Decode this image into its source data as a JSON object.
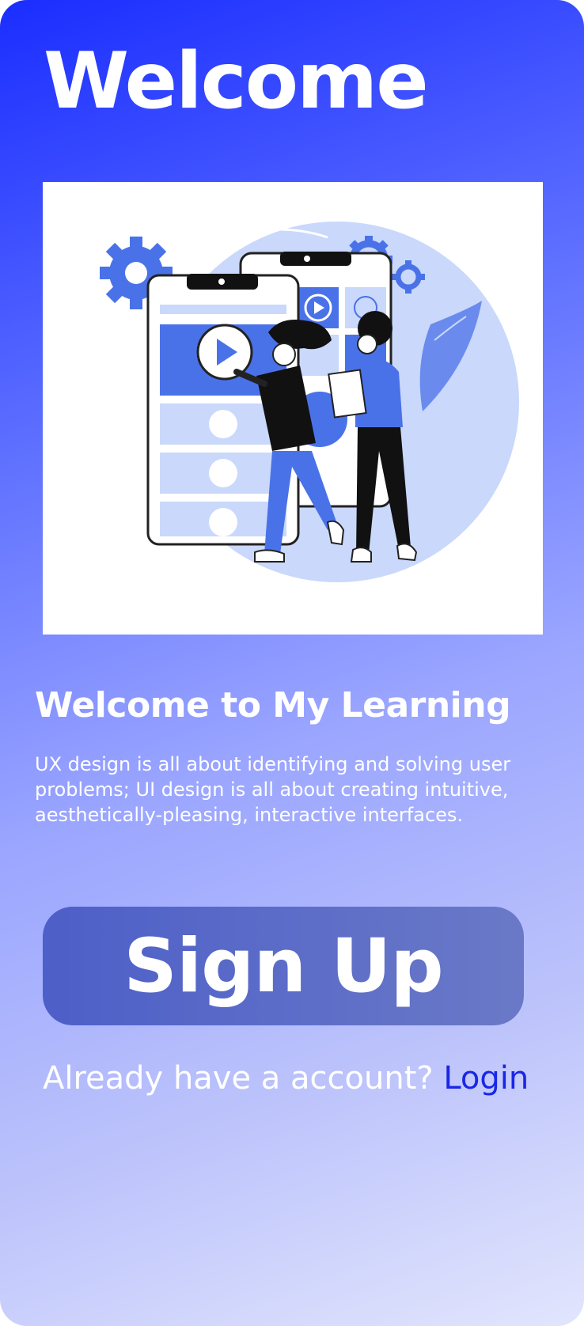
{
  "header": {
    "title": "Welcome"
  },
  "hero": {
    "illustration": "people-with-mobile-app-illustration"
  },
  "content": {
    "heading": "Welcome to My Learning",
    "description": "UX design is all about identifying and solving user problems; UI design is all about creating intuitive, aesthetically-pleasing, interactive interfaces."
  },
  "actions": {
    "signup_label": "Sign Up",
    "login_prompt": "Already have a account?",
    "login_label": "Login"
  },
  "colors": {
    "gradient_top": "#1a2dff",
    "gradient_bottom": "#e2e5fd",
    "button": "#5a6ac7",
    "link": "#1a26e6",
    "illustration_blue": "#4a72e8",
    "illustration_light": "#c9d8fb"
  }
}
